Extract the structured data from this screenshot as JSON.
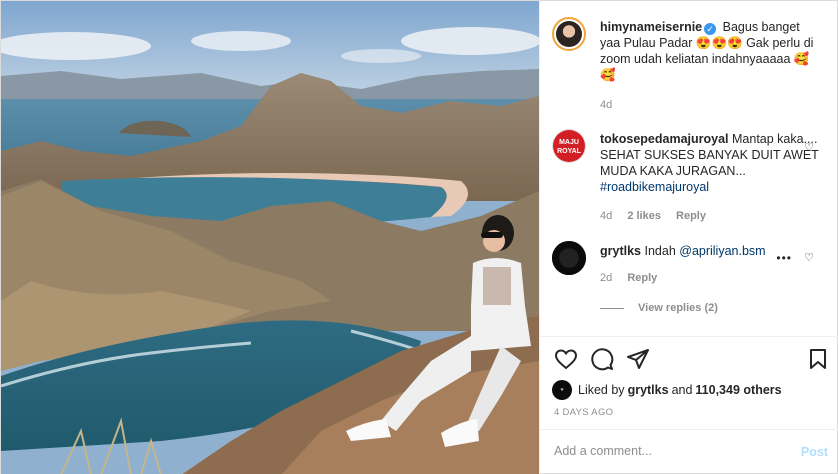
{
  "comments": [
    {
      "username": "himynameisernie",
      "verified": true,
      "text": "Bagus banget yaa Pulau Padar 😍😍😍 Gak perlu di zoom udah keliatan indahnyaaaaa 🥰🥰",
      "time": "4d"
    },
    {
      "username": "tokosepedamajuroyal",
      "text_before": "Mantap kaka.... SEHAT SUKSES BANYAK DUIT AWET MUDA KAKA JURAGAN... ",
      "hashtag": "#roadbikemajuroyal",
      "time": "4d",
      "likes": "2 likes",
      "reply": "Reply",
      "avatar_text": "MAJU ROYAL"
    },
    {
      "username": "grytlks",
      "text_before": "Indah ",
      "mention": "@apriliyan.bsm",
      "time": "2d",
      "reply": "Reply",
      "dots": "•••"
    }
  ],
  "view_replies": "View replies (2)",
  "likes_line": {
    "prefix": "Liked by",
    "user": "grytlks",
    "middle": "and",
    "count": "110,349 others"
  },
  "time_ago": "4 DAYS AGO",
  "add_comment": {
    "placeholder": "Add a comment...",
    "post_label": "Post"
  },
  "icons": {
    "like": "heart-icon",
    "comment": "comment-icon",
    "share": "share-icon",
    "save": "bookmark-icon"
  },
  "colors": {
    "link": "#00376b",
    "muted": "#8e8e8e",
    "post_disabled": "#b2dffc",
    "verified": "#3897f0"
  }
}
